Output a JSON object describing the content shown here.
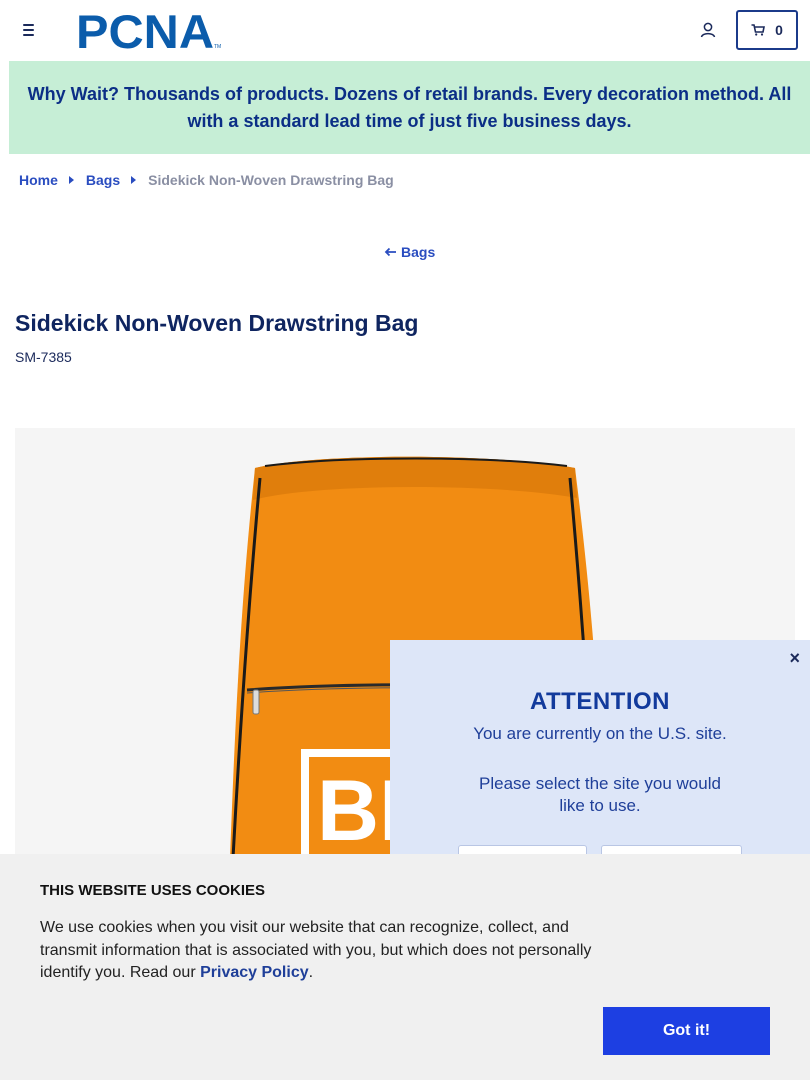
{
  "header": {
    "logo_text": "PCNA",
    "logo_tm": "TM",
    "cart_count": "0"
  },
  "banner": {
    "text": "Why Wait? Thousands of products. Dozens of retail brands. Every decoration method. All with a standard lead time of just five business days."
  },
  "breadcrumb": {
    "items": [
      "Home",
      "Bags"
    ],
    "current": "Sidekick Non-Woven Drawstring Bag"
  },
  "back_link": {
    "label": "Bags"
  },
  "product": {
    "title": "Sidekick Non-Woven Drawstring Bag",
    "sku": "SM-7385",
    "bag_color": "#f28c12",
    "imprint_text": "BE"
  },
  "popup": {
    "close": "×",
    "title": "ATTENTION",
    "line1": "You are currently on the U.S. site.",
    "line2": "Please select the site you would like to use."
  },
  "cookie": {
    "title": "THIS WEBSITE USES COOKIES",
    "text_before": "We use cookies when you visit our website that can recognize, collect, and transmit information that is associated with you, but which does not personally identify you. Read our ",
    "link": "Privacy Policy",
    "text_after": ".",
    "button": "Got it!"
  },
  "colors": {
    "brand_blue": "#0b5cab",
    "banner_bg": "#c6eed6",
    "link_blue": "#2a4dc0",
    "accent_button": "#1d3fe2"
  },
  "icons": [
    "menu-icon",
    "account-icon",
    "cart-icon",
    "chevron-right-icon",
    "arrow-left-icon",
    "close-icon"
  ]
}
